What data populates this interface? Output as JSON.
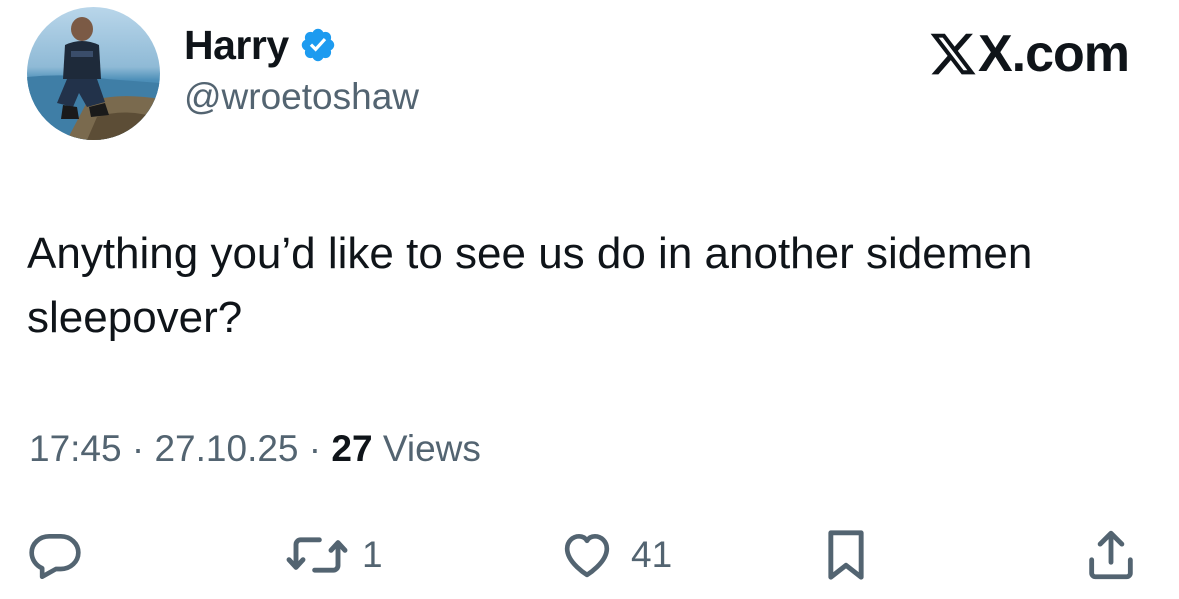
{
  "author": {
    "name": "Harry",
    "handle": "@wroetoshaw",
    "verified": true,
    "avatar": "profile-photo-person-sitting-on-cliff-by-sea"
  },
  "brand": {
    "label": "X.com",
    "icon": "x-logo"
  },
  "tweet": {
    "text": "Anything you’d like to see us do in another sidemen sleepover?"
  },
  "meta": {
    "time": "17:45",
    "separator": " · ",
    "date": "27.10.25",
    "views_count": "27",
    "views_label": " Views"
  },
  "actions": {
    "reply": {
      "icon": "reply-icon",
      "count": ""
    },
    "retweet": {
      "icon": "retweet-icon",
      "count": "1"
    },
    "like": {
      "icon": "heart-icon",
      "count": "41"
    },
    "bookmark": {
      "icon": "bookmark-icon",
      "count": ""
    },
    "share": {
      "icon": "share-icon",
      "count": ""
    }
  },
  "colors": {
    "text_primary": "#0f1419",
    "text_secondary": "#536471",
    "verified_blue": "#1d9bf0",
    "background": "#ffffff"
  }
}
